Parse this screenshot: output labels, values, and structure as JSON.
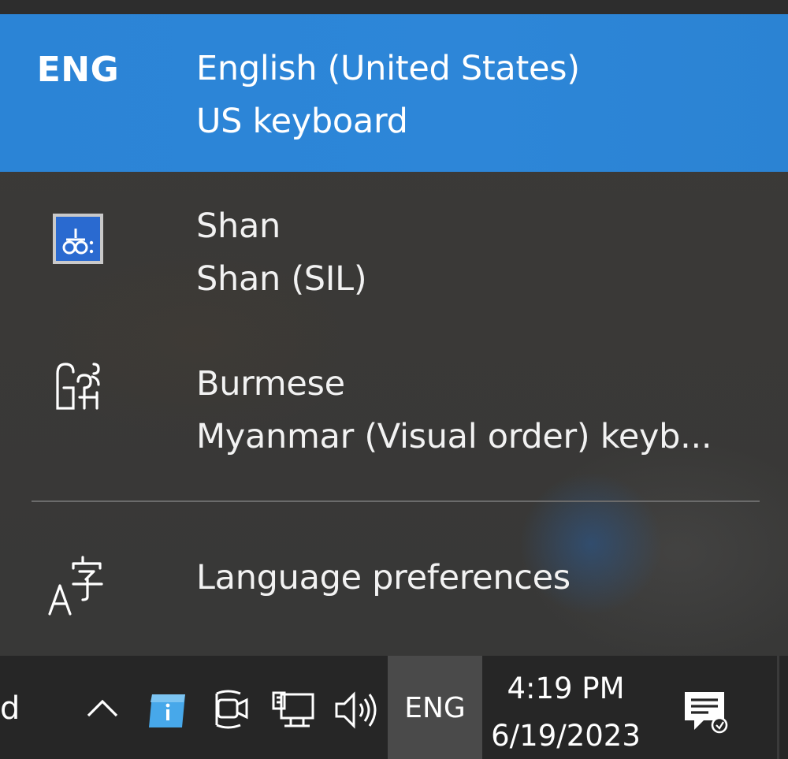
{
  "flyout": {
    "items": [
      {
        "icon_text": "ENG",
        "language": "English (United States)",
        "keyboard": "US keyboard",
        "selected": true
      },
      {
        "icon": "shan-keyboard-icon",
        "language": "Shan",
        "keyboard": "Shan (SIL)",
        "selected": false
      },
      {
        "icon": "burmese-script-icon",
        "language": "Burmese",
        "keyboard": "Myanmar (Visual order) keyb...",
        "selected": false
      }
    ],
    "preferences": {
      "icon": "language-preferences-icon",
      "label": "Language preferences"
    }
  },
  "taskbar": {
    "partial_text": "d",
    "tray_icons": [
      "chevron-up-icon",
      "info-app-icon",
      "webcam-icon",
      "network-icon",
      "volume-icon"
    ],
    "ime_indicator": "ENG",
    "clock": {
      "time": "4:19 PM",
      "date": "6/19/2023"
    },
    "notification_icon": "action-center-icon"
  },
  "colors": {
    "selected_bg": "#2b84d6",
    "flyout_bg": "#3a3937",
    "taskbar_bg": "#262626",
    "ime_hover_bg": "#4a4a4a"
  }
}
